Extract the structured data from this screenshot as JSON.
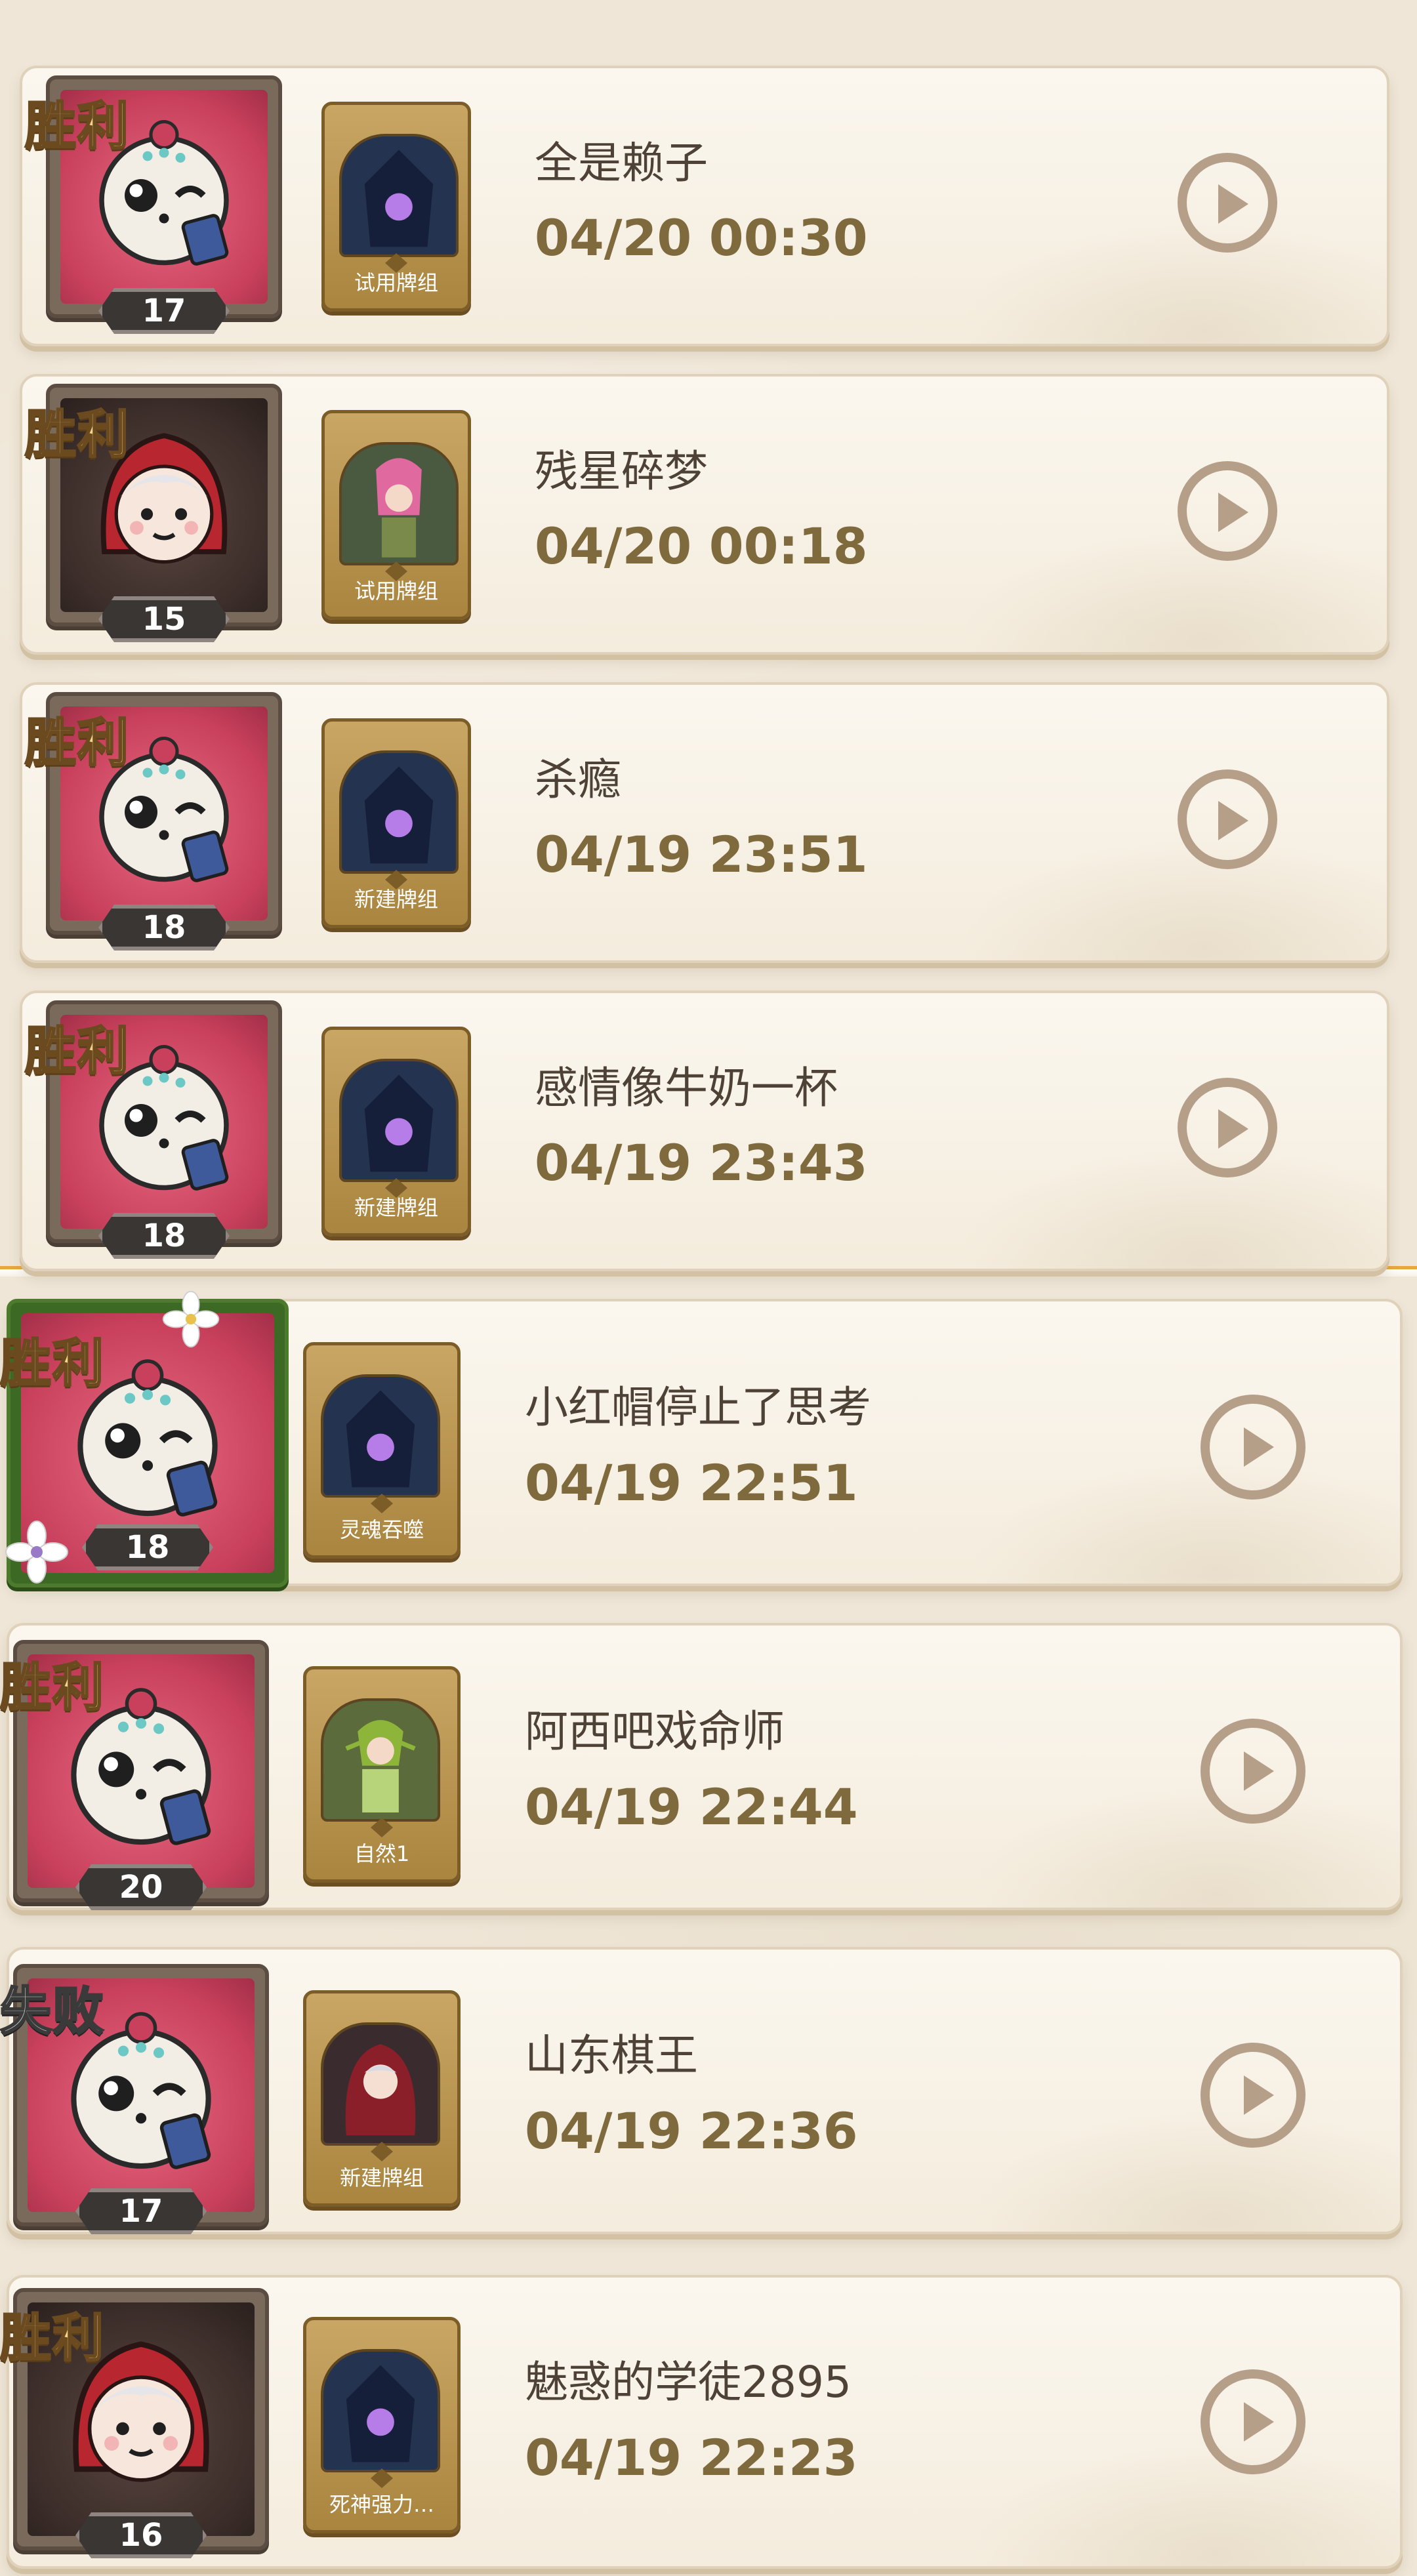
{
  "ui": {
    "play_icon": "play-circle-icon",
    "accent_gold": "#7f6a3e",
    "win_color": "#f7d48a"
  },
  "matches": [
    {
      "result": "胜利",
      "level": "17",
      "deck": "试用牌组",
      "opponent": "全是赖子",
      "time": "04/20 00:30",
      "portrait": "ferret",
      "frame": "pink"
    },
    {
      "result": "胜利",
      "level": "15",
      "deck": "试用牌组",
      "opponent": "残星碎梦",
      "time": "04/20 00:18",
      "portrait": "red-hood",
      "frame": "dark"
    },
    {
      "result": "胜利",
      "level": "18",
      "deck": "新建牌组",
      "opponent": "杀瘾",
      "time": "04/19 23:51",
      "portrait": "ferret",
      "frame": "pink"
    },
    {
      "result": "胜利",
      "level": "18",
      "deck": "新建牌组",
      "opponent": "感情像牛奶一杯",
      "time": "04/19 23:43",
      "portrait": "ferret",
      "frame": "pink"
    },
    {
      "result": "胜利",
      "level": "18",
      "deck": "灵魂吞噬",
      "opponent": "小红帽停止了思考",
      "time": "04/19 22:51",
      "portrait": "ferret",
      "frame": "vine"
    },
    {
      "result": "胜利",
      "level": "20",
      "deck": "自然1",
      "opponent": "阿西吧戏命师",
      "time": "04/19 22:44",
      "portrait": "ferret",
      "frame": "pink"
    },
    {
      "result": "失败",
      "level": "17",
      "deck": "新建牌组",
      "opponent": "山东棋王",
      "time": "04/19 22:36",
      "portrait": "ferret",
      "frame": "pink"
    },
    {
      "result": "胜利",
      "level": "16",
      "deck": "死神强力…",
      "opponent": "魅惑的学徒2895",
      "time": "04/19 22:23",
      "portrait": "red-hood",
      "frame": "dark"
    }
  ]
}
